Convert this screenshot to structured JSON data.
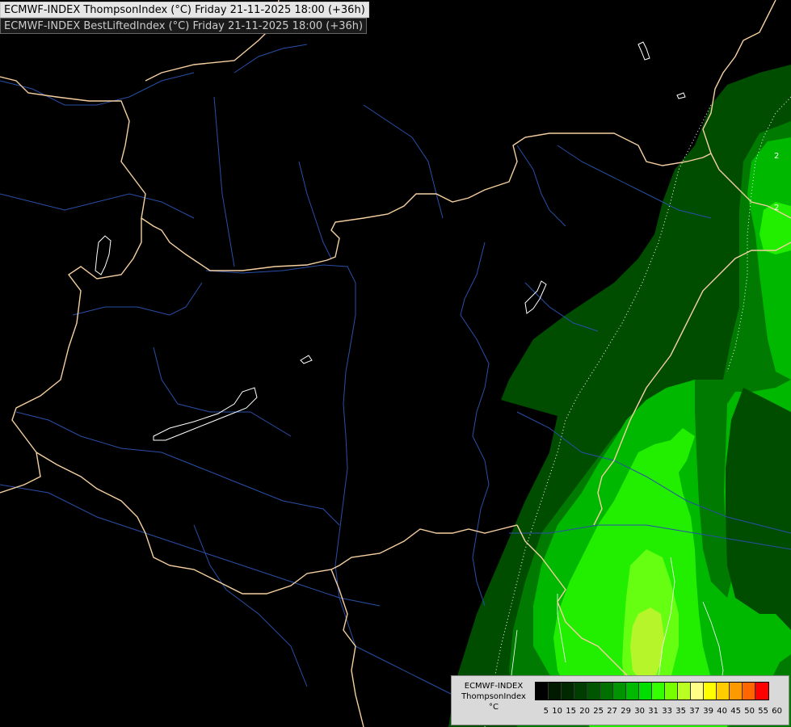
{
  "titles": {
    "line1": "ECMWF-INDEX ThompsonIndex (°C) Friday 21-11-2025 18:00 (+36h)",
    "line2": "ECMWF-INDEX BestLiftedIndex (°C) Friday 21-11-2025 18:00 (+36h)"
  },
  "legend": {
    "line1": "ECMWF-INDEX",
    "line2": "ThompsonIndex",
    "line3": "°C",
    "colors": [
      "#000000",
      "#001a00",
      "#002900",
      "#003d00",
      "#005500",
      "#007000",
      "#009500",
      "#00b900",
      "#00dd00",
      "#33ff00",
      "#77ff00",
      "#bbff22",
      "#ffff88",
      "#ffff00",
      "#ffcc00",
      "#ff9900",
      "#ff6600",
      "#ff0000",
      "#aa0000",
      "#ff00ff",
      "#cc00ff",
      "#8800ff",
      "#4400ff",
      "#0000ff"
    ],
    "ticks": [
      "5",
      "10",
      "15",
      "20",
      "25",
      "27",
      "29",
      "30",
      "31",
      "33",
      "35",
      "37",
      "39",
      "40",
      "45",
      "50",
      "55",
      "60"
    ]
  },
  "map": {
    "background": "#000000",
    "border_color": "#f5cfa0",
    "river_color": "#2a4fa8",
    "lake_color": "#ffffff",
    "fields": [
      {
        "color": "#004d00",
        "value": "20"
      },
      {
        "color": "#007a00",
        "value": "25"
      },
      {
        "color": "#00b800",
        "value": "27"
      },
      {
        "color": "#22ee00",
        "value": "29"
      },
      {
        "color": "#99ff22",
        "value": "30"
      },
      {
        "color": "#ccff33",
        "value": "31"
      }
    ],
    "contour_labels": [
      "2",
      "2"
    ]
  }
}
